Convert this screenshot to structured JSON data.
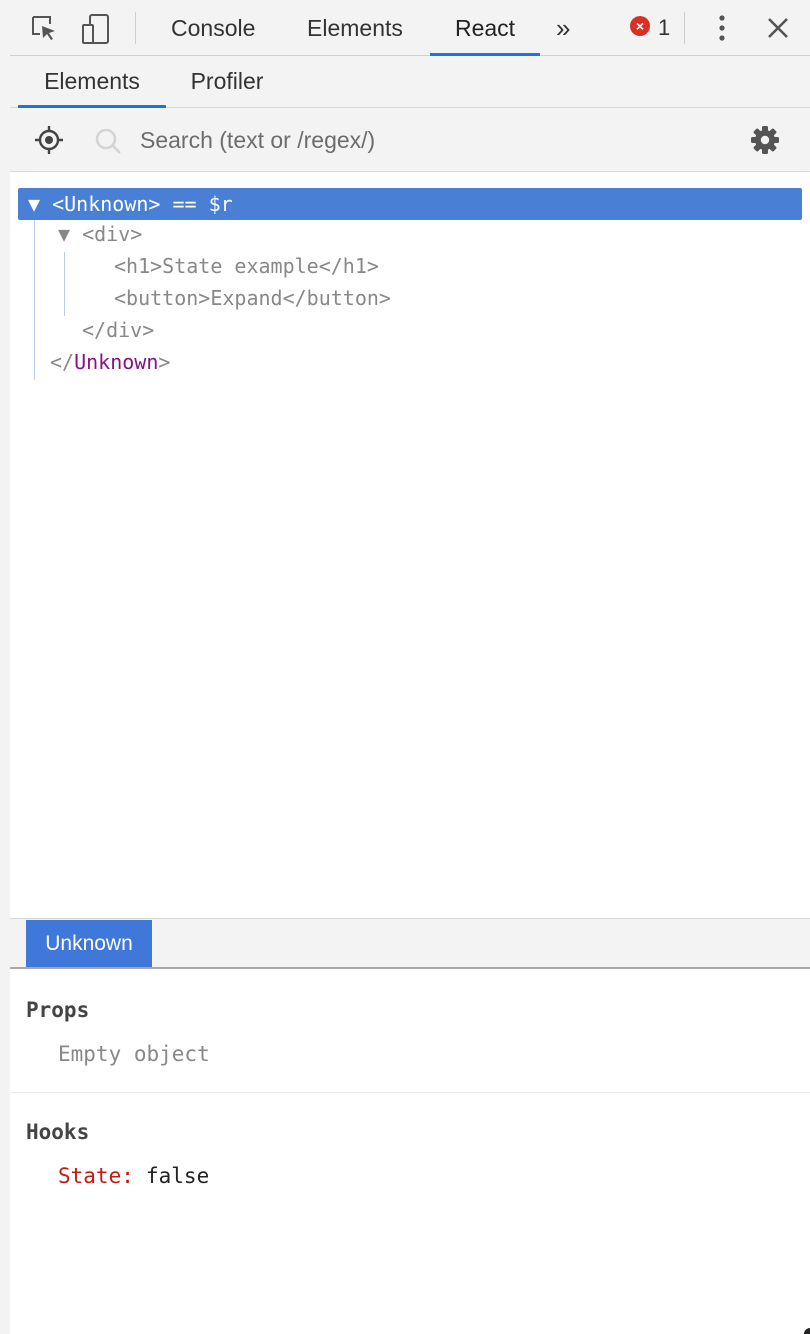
{
  "devtools": {
    "tabs": [
      {
        "label": "Console"
      },
      {
        "label": "Elements"
      },
      {
        "label": "React"
      }
    ],
    "more_tabs_glyph": "»",
    "error_count": "1",
    "icons": [
      "inspect-element-icon",
      "device-toolbar-icon",
      "more-tabs-icon",
      "error-icon",
      "kebab-menu-icon",
      "close-icon"
    ]
  },
  "react": {
    "tabs": [
      {
        "label": "Elements"
      },
      {
        "label": "Profiler"
      }
    ],
    "search": {
      "placeholder": "Search (text or /regex/)"
    },
    "tree": {
      "root": "▼ <Unknown> == $r",
      "div_open": "▼ <div>",
      "h1": "<h1>State example</h1>",
      "button": "<button>Expand</button>",
      "div_close": "</div>",
      "root_close_prefix": "</",
      "root_close_name": "Unknown",
      "root_close_suffix": ">"
    },
    "selected_component": "Unknown",
    "props": {
      "title": "Props",
      "empty_text": "Empty object"
    },
    "hooks": {
      "title": "Hooks",
      "items": [
        {
          "key": "State:",
          "value": "false"
        }
      ]
    }
  },
  "colors": {
    "accent": "#1a73e8",
    "selection": "#4a7fd6",
    "error": "#d93025",
    "hook_key": "#c41a16",
    "tag_name": "#881280"
  }
}
